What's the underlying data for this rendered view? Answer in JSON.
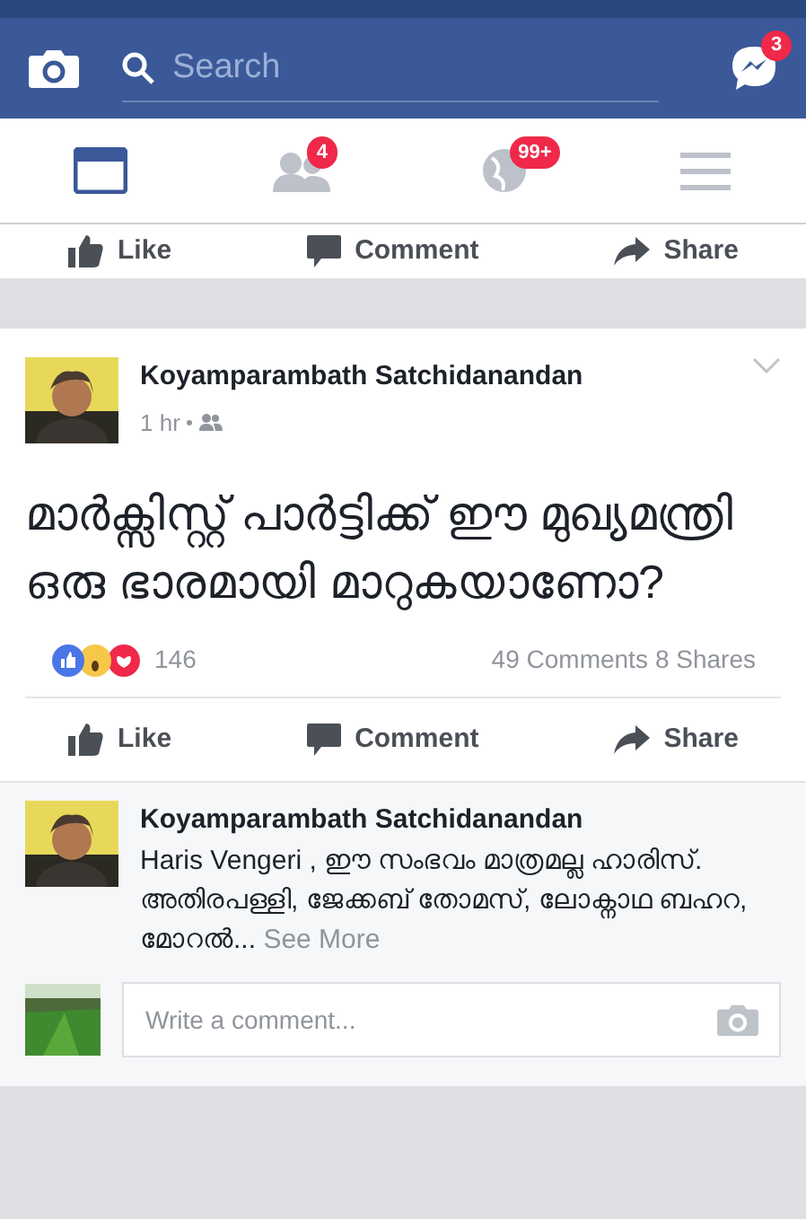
{
  "header": {
    "search_placeholder": "Search",
    "messenger_badge": "3"
  },
  "nav_tabs": [
    {
      "kind": "feed",
      "selected": true
    },
    {
      "kind": "friends",
      "selected": false,
      "badge": "4"
    },
    {
      "kind": "notifications",
      "selected": false,
      "badge": "99+"
    },
    {
      "kind": "menu",
      "selected": false
    }
  ],
  "previous_post_actions": [
    "Like",
    "Comment",
    "Share"
  ],
  "post": {
    "author": "Koyamparambath Satchidanandan",
    "time": "1 hr",
    "text": "മാർക്സിസ്റ്റ് പാർട്ടിക്ക് ഈ മുഖ്യമന്ത്രി ഒരു ഭാരമായി മാറുകയാണോ?",
    "reaction_count": "146",
    "comments": "49 Comments",
    "shares": "8 Shares",
    "actions": [
      "Like",
      "Comment",
      "Share"
    ]
  },
  "comment": {
    "author": "Koyamparambath Satchidanandan",
    "text": "Haris Vengeri , ഈ സംഭവം മാത്രമല്ല ഹാരിസ്. അതിരപള്ളി, ജേക്കബ് തോമസ്, ലോക്നാഥ ബഹറ, മോറൽ...",
    "see_more": "See More"
  },
  "comment_box": {
    "placeholder": "Write a comment..."
  }
}
